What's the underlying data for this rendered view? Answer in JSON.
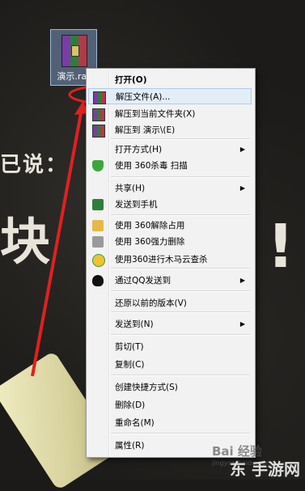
{
  "background": {
    "said_text": "已说：",
    "big_text": "块",
    "exclaim": "!"
  },
  "desktop_icon": {
    "label": "演示.rar"
  },
  "menu": {
    "items": [
      {
        "label": "打开(O)",
        "icon": "none",
        "bold": true
      },
      {
        "label": "解压文件(A)...",
        "icon": "winrar-icon",
        "highlight": true
      },
      {
        "label": "解压到当前文件夹(X)",
        "icon": "winrar-icon"
      },
      {
        "label": "解压到 演示\\(E)",
        "icon": "winrar-icon"
      },
      {
        "label": "打开方式(H)",
        "icon": "none",
        "submenu": true
      },
      {
        "label": "使用 360杀毒 扫描",
        "icon": "shield-icon"
      },
      {
        "label": "共享(H)",
        "icon": "none",
        "submenu": true
      },
      {
        "label": "发送到手机",
        "icon": "phone-icon"
      },
      {
        "label": "使用 360解除占用",
        "icon": "folder-icon"
      },
      {
        "label": "使用 360强力删除",
        "icon": "printer-icon"
      },
      {
        "label": "使用360进行木马云查杀",
        "icon": "horse-icon"
      },
      {
        "label": "通过QQ发送到",
        "icon": "qq-icon",
        "submenu": true
      },
      {
        "label": "还原以前的版本(V)",
        "icon": "none"
      },
      {
        "label": "发送到(N)",
        "icon": "none",
        "submenu": true
      },
      {
        "label": "剪切(T)",
        "icon": "none"
      },
      {
        "label": "复制(C)",
        "icon": "none"
      },
      {
        "label": "创建快捷方式(S)",
        "icon": "none"
      },
      {
        "label": "删除(D)",
        "icon": "none"
      },
      {
        "label": "重命名(M)",
        "icon": "none"
      },
      {
        "label": "属性(R)",
        "icon": "none"
      }
    ],
    "submenu_glyph": "▶"
  },
  "watermark": {
    "logo": "Bai 经验",
    "url": "jingyan.baidu.com",
    "site": "东 手游网"
  },
  "colors": {
    "arrow": "#e02020",
    "highlight_oval": "#e02020"
  }
}
